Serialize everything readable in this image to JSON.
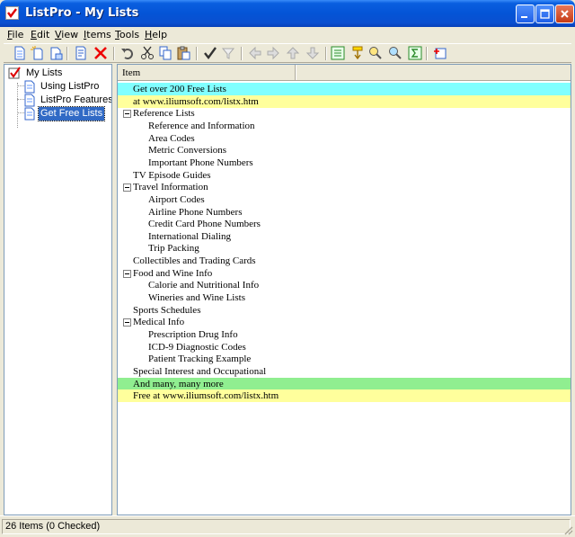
{
  "window": {
    "title": "ListPro - My Lists",
    "colors": {
      "titlebar": "#0454d6",
      "selection": "#316ac5",
      "cyan_row": "#80ffff",
      "yellow_row": "#ffff9c",
      "green_row": "#90ee90"
    }
  },
  "menu": {
    "file": {
      "key": "F",
      "rest": "ile"
    },
    "edit": {
      "key": "E",
      "rest": "dit"
    },
    "view": {
      "key": "V",
      "rest": "iew"
    },
    "items": {
      "key": "I",
      "rest": "tems"
    },
    "tools": {
      "key": "T",
      "rest": "ools"
    },
    "help": {
      "key": "H",
      "rest": "elp"
    }
  },
  "toolbar": {
    "icons": [
      "new-list-icon",
      "new-item-icon",
      "new-subitem-icon",
      "properties-icon",
      "delete-icon",
      "undo-icon",
      "cut-icon",
      "copy-icon",
      "paste-icon",
      "check-icon",
      "filter-icon",
      "move-left-icon",
      "move-right-icon",
      "move-up-icon",
      "move-down-icon",
      "expand-all-icon",
      "sort-icon",
      "find-icon",
      "find-next-icon",
      "sum-icon",
      "options-icon"
    ]
  },
  "tree": {
    "root": "My Lists",
    "items": [
      {
        "label": "Using ListPro"
      },
      {
        "label": "ListPro Features"
      },
      {
        "label": "Get Free Lists"
      }
    ]
  },
  "list": {
    "column_header": "Item",
    "rows": [
      {
        "text": "Get over 200 Free Lists",
        "level": 0,
        "color": "cyan"
      },
      {
        "text": "at www.iliumsoft.com/listx.htm",
        "level": 0,
        "color": "yellow"
      },
      {
        "text": "Reference Lists",
        "level": 0,
        "group": true
      },
      {
        "text": "Reference and Information",
        "level": 1
      },
      {
        "text": "Area Codes",
        "level": 1
      },
      {
        "text": "Metric Conversions",
        "level": 1
      },
      {
        "text": "Important Phone Numbers",
        "level": 1
      },
      {
        "text": "TV Episode Guides",
        "level": 0
      },
      {
        "text": "Travel Information",
        "level": 0,
        "group": true
      },
      {
        "text": "Airport Codes",
        "level": 1
      },
      {
        "text": "Airline Phone Numbers",
        "level": 1
      },
      {
        "text": "Credit Card Phone Numbers",
        "level": 1
      },
      {
        "text": "International Dialing",
        "level": 1
      },
      {
        "text": "Trip Packing",
        "level": 1
      },
      {
        "text": "Collectibles and Trading Cards",
        "level": 0
      },
      {
        "text": "Food and Wine Info",
        "level": 0,
        "group": true
      },
      {
        "text": "Calorie and Nutritional Info",
        "level": 1
      },
      {
        "text": "Wineries and Wine Lists",
        "level": 1
      },
      {
        "text": "Sports Schedules",
        "level": 0
      },
      {
        "text": "Medical Info",
        "level": 0,
        "group": true
      },
      {
        "text": "Prescription Drug Info",
        "level": 1
      },
      {
        "text": "ICD-9 Diagnostic Codes",
        "level": 1
      },
      {
        "text": "Patient Tracking Example",
        "level": 1
      },
      {
        "text": "Special Interest and Occupational",
        "level": 0
      },
      {
        "text": "And many, many more",
        "level": 0,
        "color": "green"
      },
      {
        "text": "Free at www.iliumsoft.com/listx.htm",
        "level": 0,
        "color": "yellow"
      }
    ]
  },
  "status": {
    "text": "26 Items (0 Checked)"
  }
}
